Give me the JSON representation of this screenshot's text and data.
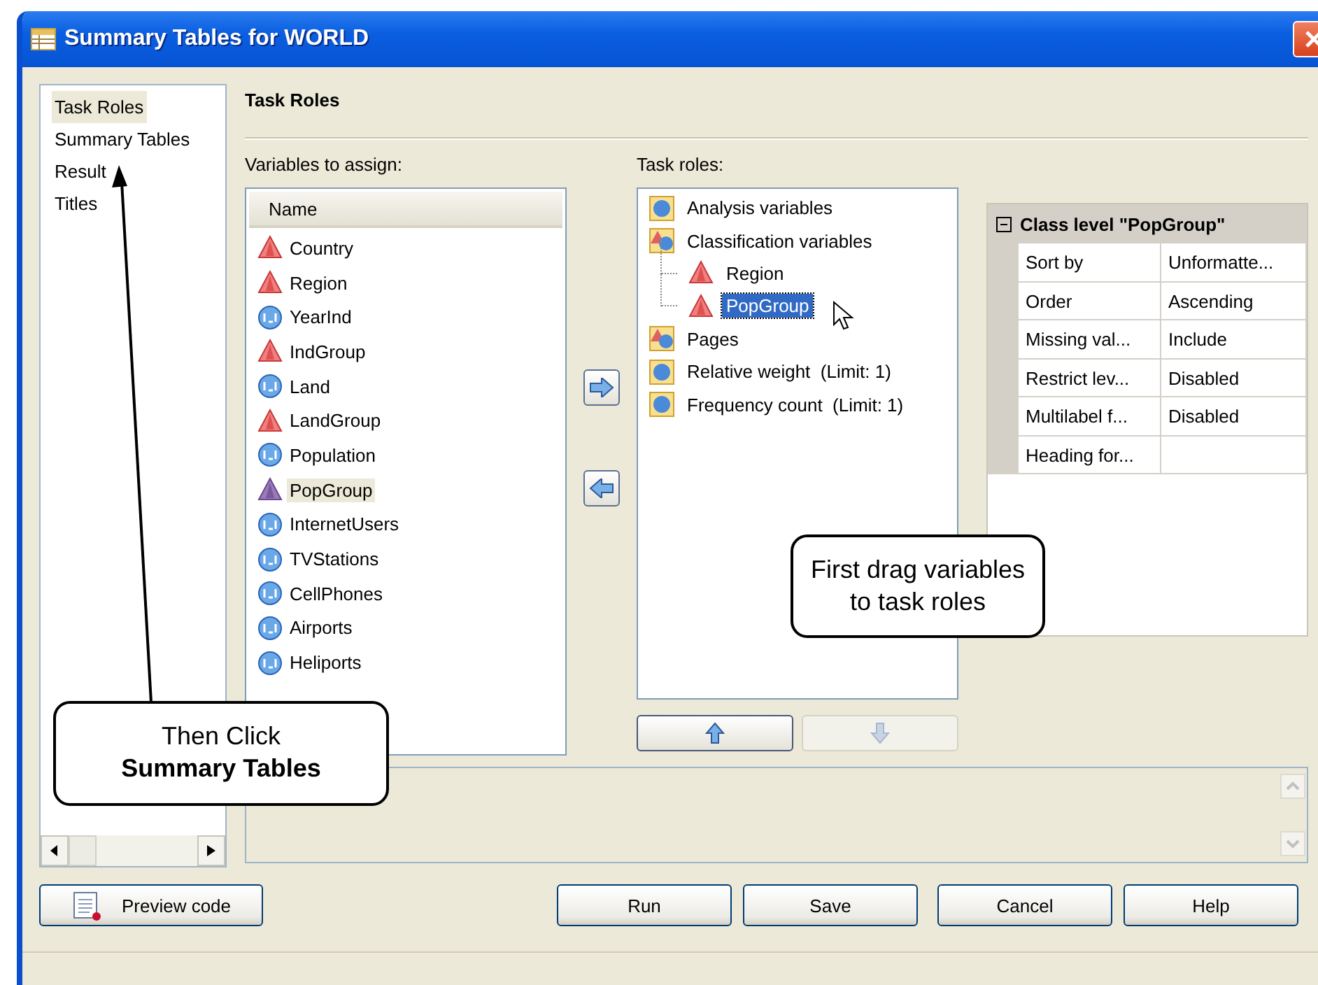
{
  "window": {
    "title": "Summary Tables for WORLD"
  },
  "nav": [
    {
      "label": "Task Roles",
      "selected": true
    },
    {
      "label": "Summary Tables",
      "selected": false
    },
    {
      "label": "Result",
      "selected": false
    },
    {
      "label": "Titles",
      "selected": false
    }
  ],
  "heading": "Task Roles",
  "variables": {
    "label": "Variables to assign:",
    "column": "Name",
    "items": [
      {
        "name": "Country",
        "kind": "category",
        "selected": false
      },
      {
        "name": "Region",
        "kind": "category",
        "selected": false
      },
      {
        "name": "YearInd",
        "kind": "numeric",
        "selected": false
      },
      {
        "name": "IndGroup",
        "kind": "category",
        "selected": false
      },
      {
        "name": "Land",
        "kind": "numeric",
        "selected": false
      },
      {
        "name": "LandGroup",
        "kind": "category",
        "selected": false
      },
      {
        "name": "Population",
        "kind": "numeric",
        "selected": false
      },
      {
        "name": "PopGroup",
        "kind": "category",
        "selected": true
      },
      {
        "name": "InternetUsers",
        "kind": "numeric",
        "selected": false
      },
      {
        "name": "TVStations",
        "kind": "numeric",
        "selected": false
      },
      {
        "name": "CellPhones",
        "kind": "numeric",
        "selected": false
      },
      {
        "name": "Airports",
        "kind": "numeric",
        "selected": false
      },
      {
        "name": "Heliports",
        "kind": "numeric",
        "selected": false
      }
    ]
  },
  "transfer_buttons": [
    {
      "kind": "add"
    },
    {
      "kind": "remove"
    }
  ],
  "task_roles": {
    "label": "Task roles:",
    "items": [
      {
        "name": "Analysis variables",
        "kind": "single",
        "selected": false
      },
      {
        "name": "Classification variables",
        "kind": "multi",
        "selected": false,
        "children": [
          {
            "name": "Region",
            "kind": "category",
            "selected": false
          },
          {
            "name": "PopGroup",
            "kind": "category",
            "selected": true
          }
        ]
      },
      {
        "name": "Pages",
        "kind": "multi",
        "selected": false
      },
      {
        "name": "Relative weight  (Limit: 1)",
        "kind": "single",
        "selected": false
      },
      {
        "name": "Frequency count  (Limit: 1)",
        "kind": "single",
        "selected": false
      }
    ]
  },
  "move_buttons": [
    {
      "kind": "up",
      "disabled": false
    },
    {
      "kind": "down",
      "disabled": true
    }
  ],
  "properties": {
    "title": "Class level \"PopGroup\"",
    "expanded": true,
    "rows": [
      {
        "name": "Sort by",
        "value": "Unformatte..."
      },
      {
        "name": "Order",
        "value": "Ascending"
      },
      {
        "name": "Missing val...",
        "value": "Include"
      },
      {
        "name": "Restrict lev...",
        "value": "Disabled"
      },
      {
        "name": "Multilabel f...",
        "value": "Disabled"
      },
      {
        "name": "Heading for..."
      }
    ]
  },
  "buttons": [
    {
      "label": "Preview code",
      "kind": "preview"
    },
    {
      "label": "Run",
      "kind": "plain"
    },
    {
      "label": "Save",
      "kind": "plain"
    },
    {
      "label": "Cancel",
      "kind": "plain"
    },
    {
      "label": "Help",
      "kind": "plain"
    }
  ],
  "callouts": [
    {
      "text": "First drag variables\nto task roles",
      "kind": "plain"
    },
    {
      "text": "Then Click\n**Summary Tables**",
      "kind": "arrow"
    }
  ]
}
